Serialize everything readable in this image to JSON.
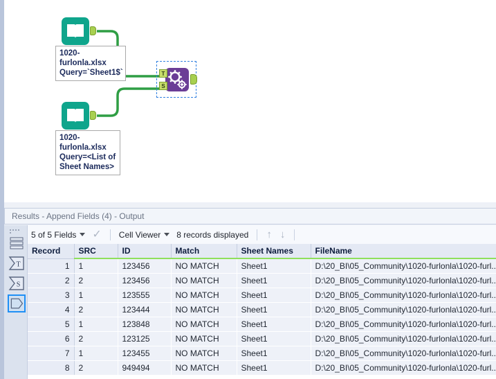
{
  "canvas": {
    "nodes": [
      {
        "name": "input-data-tool-1",
        "icon": "book-icon",
        "label": "1020-\nfurlonla.xlsx\nQuery=`Sheet1$`"
      },
      {
        "name": "input-data-tool-2",
        "icon": "book-icon",
        "label": "1020-\nfurlonla.xlsx\nQuery=<List of\nSheet Names>"
      }
    ],
    "tool": {
      "name": "append-fields-tool",
      "icon": "gears-icon",
      "port_target": "T",
      "port_source": "S",
      "color": "#6b3d96"
    },
    "wire_color": "#2f9e44",
    "connector_color": "#a8d050"
  },
  "results": {
    "title": "Results - Append Fields (4) - Output",
    "toolbar": {
      "fields_label": "5 of 5 Fields",
      "fields_caret": "chevron-down-icon",
      "check_icon": "check-icon",
      "viewer_label": "Cell Viewer",
      "viewer_caret": "chevron-down-icon",
      "records_label": "8 records displayed",
      "prev_icon": "arrow-up-icon",
      "next_icon": "arrow-down-icon"
    },
    "rail": [
      {
        "name": "rail-icon-messages",
        "icon": "list-icon",
        "selected": false
      },
      {
        "name": "rail-icon-input-t",
        "icon": "sigma-t-icon",
        "selected": false
      },
      {
        "name": "rail-icon-input-s",
        "icon": "sigma-s-icon",
        "selected": false
      },
      {
        "name": "rail-icon-output",
        "icon": "output-anchor-icon",
        "selected": true
      }
    ],
    "grid": {
      "columns": [
        "Record",
        "SRC",
        "ID",
        "Match",
        "Sheet Names",
        "FileName"
      ],
      "rows": [
        [
          "1",
          "1",
          "123456",
          "NO MATCH",
          "Sheet1",
          "D:\\20_BI\\05_Community\\1020-furlonla\\1020-furl..."
        ],
        [
          "2",
          "2",
          "123456",
          "NO MATCH",
          "Sheet1",
          "D:\\20_BI\\05_Community\\1020-furlonla\\1020-furl..."
        ],
        [
          "3",
          "1",
          "123555",
          "NO MATCH",
          "Sheet1",
          "D:\\20_BI\\05_Community\\1020-furlonla\\1020-furl..."
        ],
        [
          "4",
          "2",
          "123444",
          "NO MATCH",
          "Sheet1",
          "D:\\20_BI\\05_Community\\1020-furlonla\\1020-furl..."
        ],
        [
          "5",
          "1",
          "123848",
          "NO MATCH",
          "Sheet1",
          "D:\\20_BI\\05_Community\\1020-furlonla\\1020-furl..."
        ],
        [
          "6",
          "2",
          "123125",
          "NO MATCH",
          "Sheet1",
          "D:\\20_BI\\05_Community\\1020-furlonla\\1020-furl..."
        ],
        [
          "7",
          "1",
          "123455",
          "NO MATCH",
          "Sheet1",
          "D:\\20_BI\\05_Community\\1020-furlonla\\1020-furl..."
        ],
        [
          "8",
          "2",
          "949494",
          "NO MATCH",
          "Sheet1",
          "D:\\20_BI\\05_Community\\1020-furlonla\\1020-furl..."
        ]
      ]
    }
  }
}
